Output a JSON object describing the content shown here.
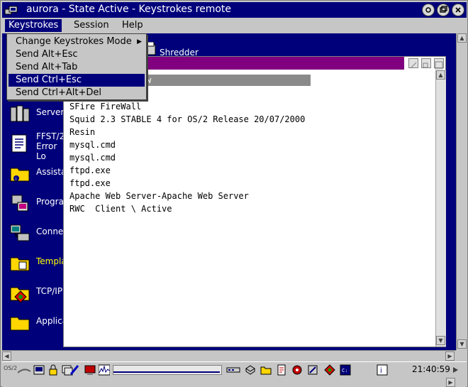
{
  "window": {
    "title": "aurora - State Active - Keystrokes remote",
    "controls": [
      "restore-icon",
      "maximize-icon",
      "close-icon"
    ]
  },
  "menubar": {
    "items": [
      {
        "label": "Keystrokes",
        "active": true
      },
      {
        "label": "Session",
        "active": false
      },
      {
        "label": "Help",
        "active": false
      }
    ]
  },
  "keystrokes_menu": {
    "items": [
      {
        "label": "Change Keystrokes Mode",
        "submenu": true,
        "selected": false
      },
      {
        "label": "Send Alt+Esc",
        "selected": false
      },
      {
        "label": "Send Alt+Tab",
        "selected": false
      },
      {
        "label": "Send Ctrl+Esc",
        "selected": true
      },
      {
        "label": "Send Ctrl+Alt+Del",
        "selected": false
      }
    ]
  },
  "desktop": {
    "shredder_label": "Shredder",
    "icons": [
      {
        "label": "Server",
        "icon": "server-icon"
      },
      {
        "label": "FFST/2 Error Lo",
        "icon": "ffst-icon"
      },
      {
        "label": "Assista",
        "icon": "assistance-folder-icon"
      },
      {
        "label": "Progran",
        "icon": "programs-icon"
      },
      {
        "label": "Connec",
        "icon": "connections-icon"
      },
      {
        "label": "Templa",
        "icon": "templates-folder-icon"
      },
      {
        "label": "TCP/IP",
        "icon": "tcpip-icon"
      },
      {
        "label": "Applica",
        "icon": "applications-folder-icon"
      }
    ]
  },
  "task_list": {
    "highlighted_fragment": "w",
    "items": [
      "SFire FireWall",
      "Squid 2.3 STABLE 4 for OS/2 Release 20/07/2000",
      "Resin",
      "mysql.cmd",
      "mysql.cmd",
      "ftpd.exe",
      "ftpd.exe",
      "Apache Web Server-Apache Web Server",
      "RWC  Client \\ Active"
    ]
  },
  "taskbar": {
    "logo_text": "OS/2",
    "clock": "21:40:59"
  },
  "colors": {
    "titlebar": "#00007b",
    "desktop": "#00007b",
    "list_title": "#800080",
    "menu_highlight": "#00007b"
  }
}
